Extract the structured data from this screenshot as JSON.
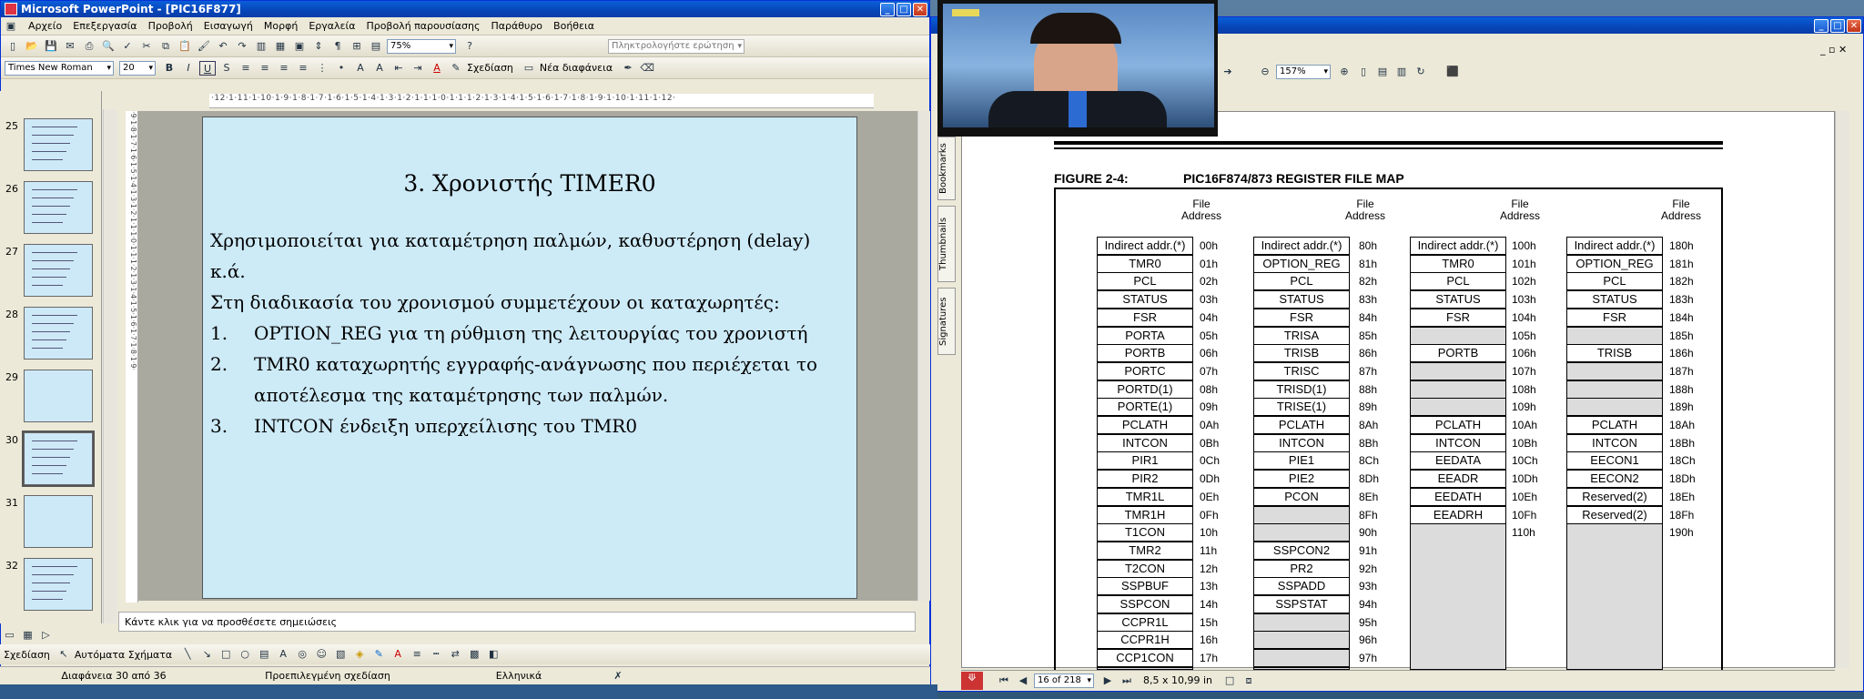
{
  "ppt": {
    "title": "Microsoft PowerPoint - [PIC16F877]",
    "menu": [
      "Αρχείο",
      "Επεξεργασία",
      "Προβολή",
      "Εισαγωγή",
      "Μορφή",
      "Εργαλεία",
      "Προβολή παρουσίασης",
      "Παράθυρο",
      "Βοήθεια"
    ],
    "help_placeholder": "Πληκτρολογήστε ερώτηση",
    "font_name": "Times New Roman",
    "font_size": "20",
    "zoom": "75%",
    "design_label": "Σχεδίαση",
    "new_slide_label": "Νέα διαφάνεια",
    "thumb_numbers": [
      "25",
      "26",
      "27",
      "28",
      "29",
      "30",
      "31",
      "32"
    ],
    "slide": {
      "title": "3. Χρονιστής TIMER0",
      "line1": "Χρησιμοποιείται για καταμέτρηση παλμών, καθυστέρηση (delay) κ.ά.",
      "line2": "Στη διαδικασία του χρονισμού συμμετέχουν οι καταχωρητές:",
      "items": [
        {
          "num": "1.",
          "text": "OPTION_REG για τη ρύθμιση της λειτουργίας του χρονιστή"
        },
        {
          "num": "2.",
          "text": "TMR0 καταχωρητής εγγραφής-ανάγνωσης που περιέχεται το αποτέλεσμα της καταμέτρησης των παλμών."
        },
        {
          "num": "3.",
          "text": "INTCON ένδειξη υπερχείλισης του TMR0"
        }
      ]
    },
    "notes_placeholder": "Κάντε κλικ για να προσθέσετε σημειώσεις",
    "draw_label": "Σχεδίαση",
    "autoshapes_label": "Αυτόματα Σχήματα",
    "status": {
      "slide": "Διαφάνεια 30 από 36",
      "design": "Προεπιλεγμένη σχεδίαση",
      "lang": "Ελληνικά"
    }
  },
  "pdf": {
    "zoom": "157%",
    "page": "16 of 218",
    "size": "8,5 x 10,99 in",
    "side_tabs": [
      "Bookmarks",
      "Thumbnails",
      "Signatures"
    ],
    "figure_label": "FIGURE 2-4:",
    "figure_title": "PIC16F874/873 REGISTER FILE MAP",
    "file_address": "File Address",
    "banks": [
      {
        "regs": [
          "Indirect addr.(*)",
          "TMR0",
          "PCL",
          "STATUS",
          "FSR",
          "PORTA",
          "PORTB",
          "PORTC",
          "PORTD(1)",
          "PORTE(1)",
          "PCLATH",
          "INTCON",
          "PIR1",
          "PIR2",
          "TMR1L",
          "TMR1H",
          "T1CON",
          "TMR2",
          "T2CON",
          "SSPBUF",
          "SSPCON",
          "CCPR1L",
          "CCPR1H",
          "CCP1CON"
        ],
        "addrs": [
          "00h",
          "01h",
          "02h",
          "03h",
          "04h",
          "05h",
          "06h",
          "07h",
          "08h",
          "09h",
          "0Ah",
          "0Bh",
          "0Ch",
          "0Dh",
          "0Eh",
          "0Fh",
          "10h",
          "11h",
          "12h",
          "13h",
          "14h",
          "15h",
          "16h",
          "17h"
        ]
      },
      {
        "regs": [
          "Indirect addr.(*)",
          "OPTION_REG",
          "PCL",
          "STATUS",
          "FSR",
          "TRISA",
          "TRISB",
          "TRISC",
          "TRISD(1)",
          "TRISE(1)",
          "PCLATH",
          "INTCON",
          "PIE1",
          "PIE2",
          "PCON",
          "",
          "",
          "SSPCON2",
          "PR2",
          "SSPADD",
          "SSPSTAT",
          "",
          "",
          ""
        ],
        "addrs": [
          "80h",
          "81h",
          "82h",
          "83h",
          "84h",
          "85h",
          "86h",
          "87h",
          "88h",
          "89h",
          "8Ah",
          "8Bh",
          "8Ch",
          "8Dh",
          "8Eh",
          "8Fh",
          "90h",
          "91h",
          "92h",
          "93h",
          "94h",
          "95h",
          "96h",
          "97h"
        ]
      },
      {
        "regs": [
          "Indirect addr.(*)",
          "TMR0",
          "PCL",
          "STATUS",
          "FSR",
          "",
          "PORTB",
          "",
          "",
          "",
          "PCLATH",
          "INTCON",
          "EEDATA",
          "EEADR",
          "EEDATH",
          "EEADRH"
        ],
        "addrs": [
          "100h",
          "101h",
          "102h",
          "103h",
          "104h",
          "105h",
          "106h",
          "107h",
          "108h",
          "109h",
          "10Ah",
          "10Bh",
          "10Ch",
          "10Dh",
          "10Eh",
          "10Fh",
          "110h"
        ]
      },
      {
        "regs": [
          "Indirect addr.(*)",
          "OPTION_REG",
          "PCL",
          "STATUS",
          "FSR",
          "",
          "TRISB",
          "",
          "",
          "",
          "PCLATH",
          "INTCON",
          "EECON1",
          "EECON2",
          "Reserved(2)",
          "Reserved(2)"
        ],
        "addrs": [
          "180h",
          "181h",
          "182h",
          "183h",
          "184h",
          "185h",
          "186h",
          "187h",
          "188h",
          "189h",
          "18Ah",
          "18Bh",
          "18Ch",
          "18Dh",
          "18Eh",
          "18Fh",
          "190h"
        ]
      }
    ]
  }
}
